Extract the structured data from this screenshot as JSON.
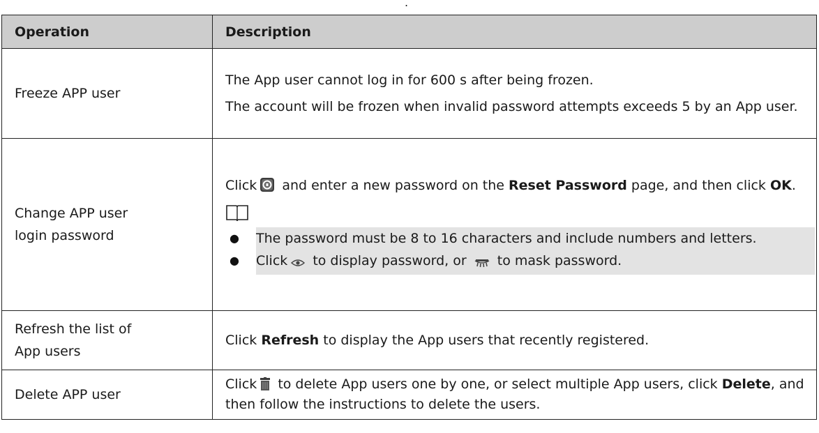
{
  "table": {
    "headers": {
      "operation": "Operation",
      "description": "Description"
    },
    "rows": {
      "freeze": {
        "operation": "Freeze APP user",
        "desc_1": "The App user cannot log in for 600 s after being frozen.",
        "desc_2": "The account will be frozen when invalid password attempts exceeds 5 by an App user."
      },
      "change_password": {
        "operation_line1": "Change APP user",
        "operation_line2": "login password",
        "click": "Click",
        "text_a": " and enter a new password on the ",
        "reset_password": "Reset Password",
        "text_b": " page, and then click ",
        "ok": "OK",
        "period": ".",
        "note_1": "The password must be 8 to 16 characters and include numbers and letters.",
        "note_2_click": "Click",
        "note_2_mid": " to display password, or ",
        "note_2_end": " to mask password."
      },
      "refresh": {
        "operation_line1": "Refresh the list of",
        "operation_line2": "App users",
        "click": "Click ",
        "refresh": "Refresh",
        "text": " to display the App users that recently registered."
      },
      "delete": {
        "operation": "Delete APP user",
        "click": "Click",
        "text_a": " to delete App users one by one, or select multiple App users, click ",
        "delete": "Delete",
        "text_b": ", and then follow the instructions to delete the users."
      }
    }
  },
  "icons": [
    "reset-password-lock-icon",
    "note-book-icon",
    "show-password-eye-icon",
    "hide-password-eye-icon",
    "delete-trash-icon"
  ]
}
